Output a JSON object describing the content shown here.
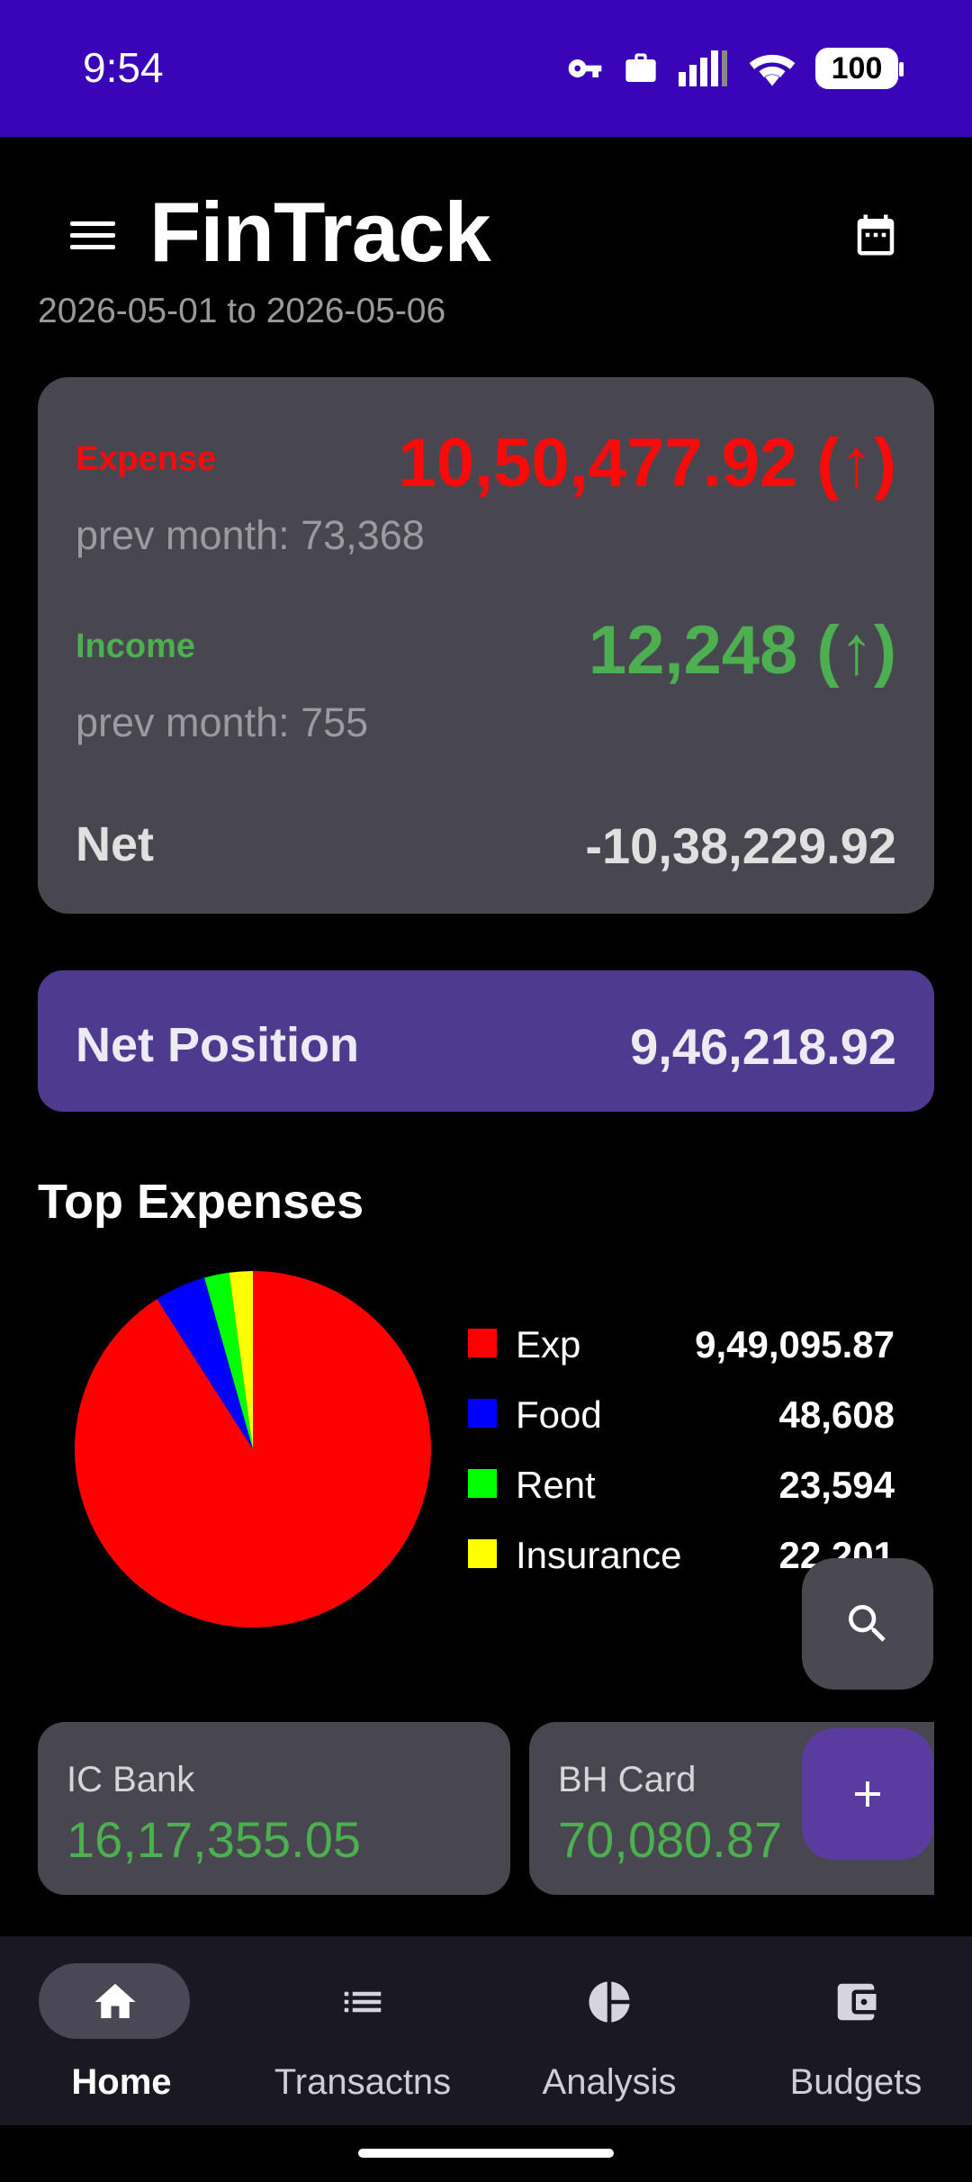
{
  "status_bar": {
    "time": "9:54",
    "battery": "100"
  },
  "header": {
    "title": "FinTrack",
    "date_range": "2026-05-01 to 2026-05-06"
  },
  "summary": {
    "expense_label": "Expense",
    "expense_value": "10,50,477.92 (↑)",
    "expense_prev": "prev month: 73,368",
    "income_label": "Income",
    "income_value": "12,248 (↑)",
    "income_prev": "prev month: 755",
    "net_label": "Net",
    "net_value": "-10,38,229.92"
  },
  "net_position": {
    "label": "Net Position",
    "value": "9,46,218.92"
  },
  "top_expenses": {
    "title": "Top Expenses",
    "items": [
      {
        "name": "Exp",
        "value": "9,49,095.87",
        "color": "#ff0000"
      },
      {
        "name": "Food",
        "value": "48,608",
        "color": "#0000ff"
      },
      {
        "name": "Rent",
        "value": "23,594",
        "color": "#00ff00"
      },
      {
        "name": "Insurance",
        "value": "22,201",
        "color": "#ffff00"
      }
    ]
  },
  "chart_data": {
    "type": "pie",
    "categories": [
      "Exp",
      "Food",
      "Rent",
      "Insurance"
    ],
    "values": [
      949095.87,
      48608,
      23594,
      22201
    ],
    "colors": [
      "#ff0000",
      "#0000ff",
      "#00ff00",
      "#ffff00"
    ]
  },
  "accounts": [
    {
      "name": "IC Bank",
      "value": "16,17,355.05"
    },
    {
      "name": "BH Card",
      "value": "70,080.87"
    }
  ],
  "fab": {
    "search_icon": "search-icon",
    "add_icon": "plus-icon"
  },
  "nav": [
    {
      "label": "Home",
      "icon": "home-icon",
      "active": true
    },
    {
      "label": "Transactns",
      "icon": "list-icon",
      "active": false
    },
    {
      "label": "Analysis",
      "icon": "pie-chart-icon",
      "active": false
    },
    {
      "label": "Budgets",
      "icon": "wallet-icon",
      "active": false
    }
  ]
}
